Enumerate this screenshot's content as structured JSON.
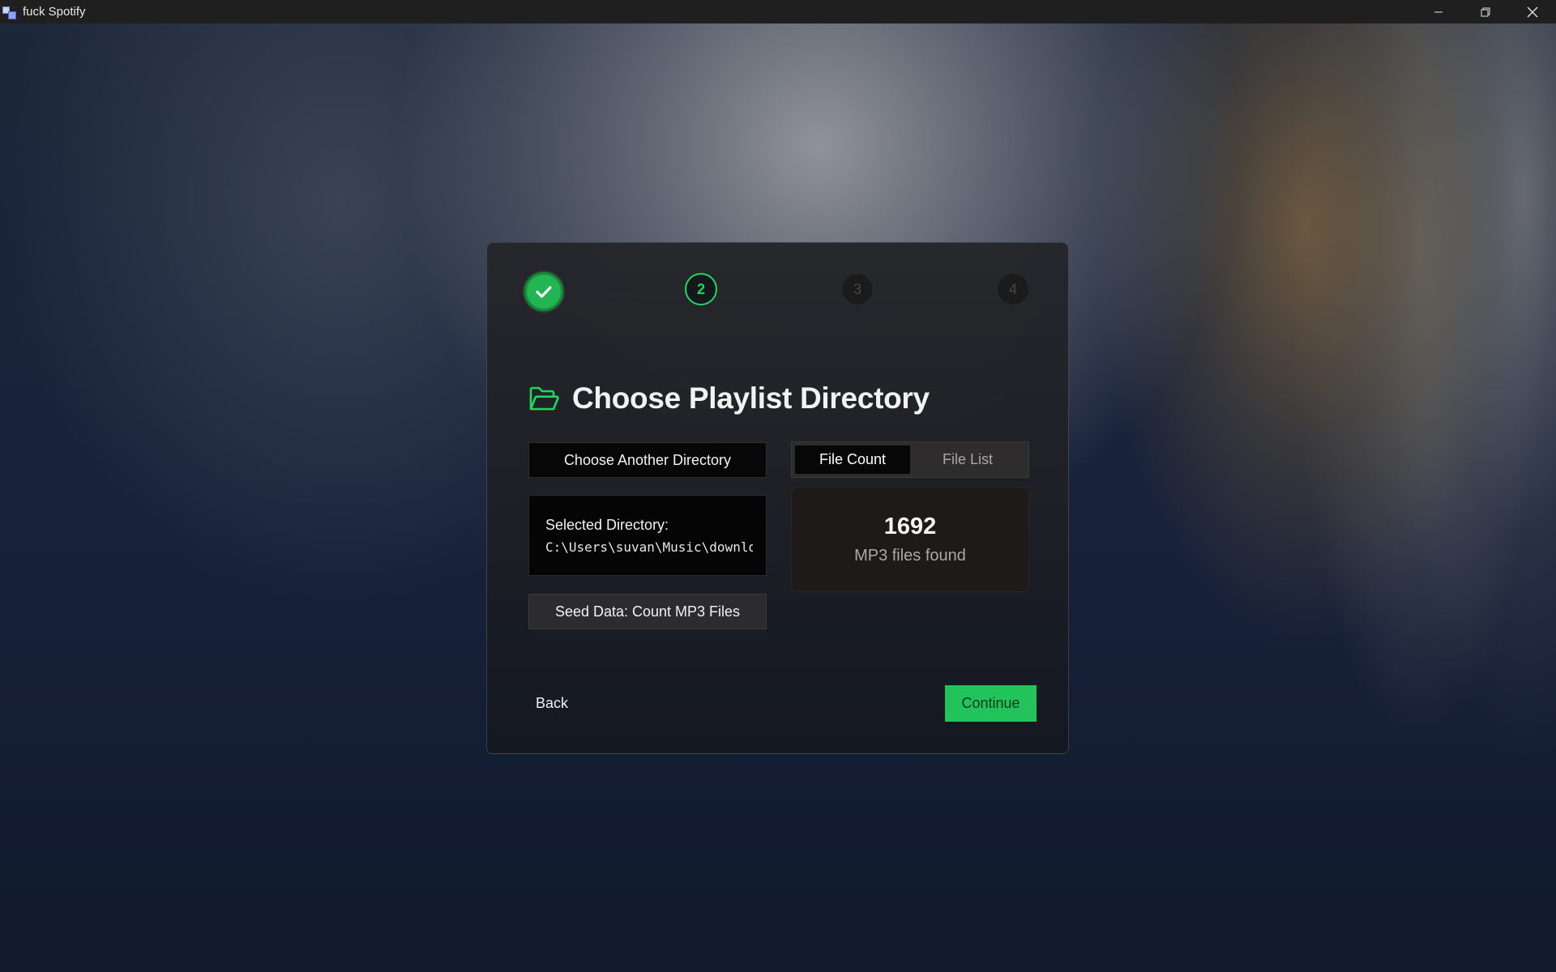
{
  "window": {
    "title": "fuck Spotify",
    "controls": {
      "minimize": "minimize-icon",
      "restore": "restore-icon",
      "close": "close-icon"
    }
  },
  "stepper": {
    "steps": [
      {
        "label": "",
        "state": "done",
        "icon": "check-icon"
      },
      {
        "label": "2",
        "state": "active"
      },
      {
        "label": "3",
        "state": "todo"
      },
      {
        "label": "4",
        "state": "todo"
      }
    ]
  },
  "page": {
    "heading": "Choose Playlist Directory",
    "heading_icon": "folder-open-icon"
  },
  "directory": {
    "choose_button": "Choose Another Directory",
    "selected_label": "Selected Directory:",
    "selected_path": "C:\\Users\\suvan\\Music\\downloads",
    "seed_button": "Seed Data: Count MP3 Files"
  },
  "tabs": {
    "file_count": "File Count",
    "file_list": "File List",
    "active": "File Count"
  },
  "result": {
    "count": "1692",
    "caption": "MP3 files found"
  },
  "nav": {
    "back": "Back",
    "continue": "Continue"
  },
  "colors": {
    "accent": "#1ed760",
    "done_step": "#22b552",
    "continue_bg": "#22c35a"
  }
}
